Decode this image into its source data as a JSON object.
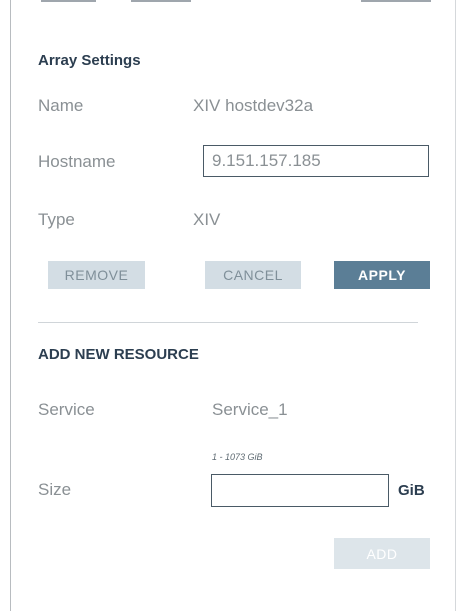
{
  "array_settings": {
    "title": "Array Settings",
    "name_label": "Name",
    "name_value": "XIV hostdev32a",
    "hostname_label": "Hostname",
    "hostname_value": "9.151.157.185",
    "type_label": "Type",
    "type_value": "XIV",
    "remove_label": "REMOVE",
    "cancel_label": "CANCEL",
    "apply_label": "APPLY"
  },
  "add_resource": {
    "title": "ADD NEW RESOURCE",
    "service_label": "Service",
    "service_value": "Service_1",
    "size_label": "Size",
    "size_range": "1 - 1073 GiB",
    "size_value": "",
    "size_unit": "GiB",
    "add_label": "ADD"
  },
  "colors": {
    "primary_button": "#5b7e96",
    "secondary_button": "#d3dde4",
    "heading_text": "#2c3e50",
    "label_text": "#8a9094"
  }
}
